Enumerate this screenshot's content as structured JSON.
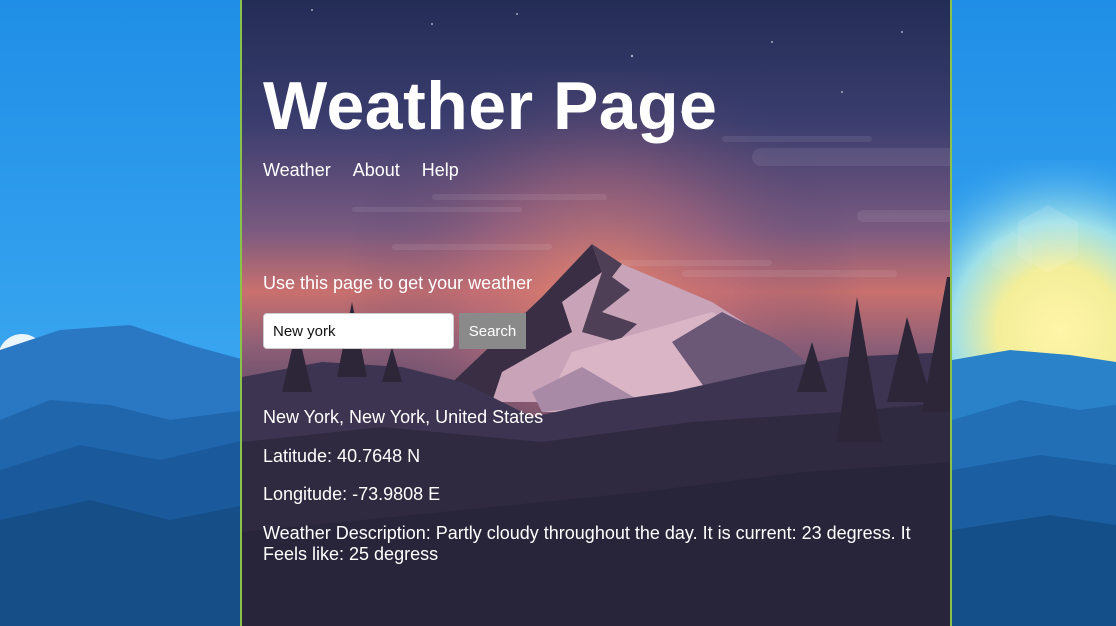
{
  "page": {
    "title": "Weather Page"
  },
  "nav": {
    "items": [
      "Weather",
      "About",
      "Help"
    ]
  },
  "intro": {
    "text": "Use this page to get your weather"
  },
  "search": {
    "value": "New york",
    "button_label": "Search"
  },
  "results": {
    "location": "New York, New York, United States",
    "latitude": "Latitude: 40.7648 N",
    "longitude": "Longitude: -73.9808 E",
    "description": "Weather Description: Partly cloudy throughout the day. It is current: 23 degress. It Feels like: 25 degress"
  },
  "colors": {
    "card_border": "#8bc34a",
    "text": "#ffffff",
    "button_bg": "#8a8a8a",
    "sky_top": "#1f2a55",
    "sunset_glow": "#e07a68",
    "wallpaper_blue": "#1e8de0"
  }
}
